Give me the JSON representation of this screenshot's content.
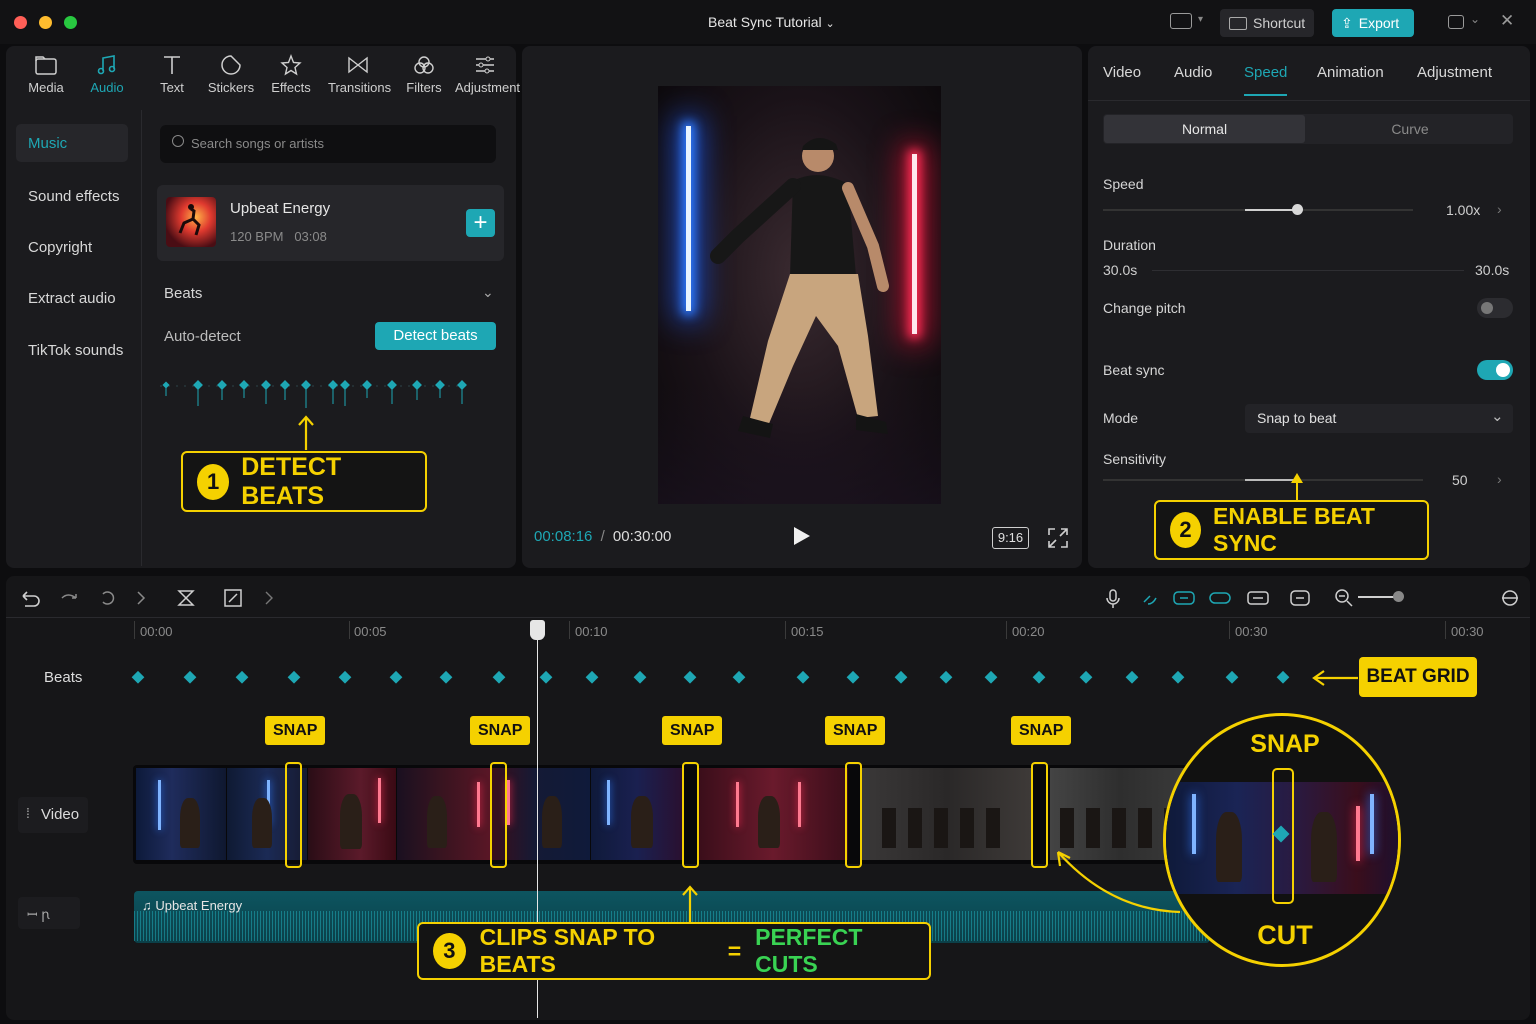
{
  "window": {
    "title": "Beat Sync Tutorial",
    "shortcut_label": "Shortcut",
    "export_label": "Export"
  },
  "toolbar": {
    "tools": [
      "Media",
      "Audio",
      "Text",
      "Stickers",
      "Effects",
      "Transitions",
      "Filters",
      "Adjustment"
    ],
    "active": "Audio"
  },
  "audio_sidebar": {
    "items": [
      "Music",
      "Sound effects",
      "Copyright",
      "Extract audio",
      "TikTok sounds"
    ],
    "active": "Music"
  },
  "search": {
    "placeholder": "Search songs or artists"
  },
  "track": {
    "title": "Upbeat Energy",
    "bpm": "120 BPM",
    "duration": "03:08"
  },
  "beats_section": {
    "title": "Beats",
    "auto_detect": "Auto-detect",
    "detect_button": "Detect beats"
  },
  "callouts": {
    "c1": {
      "number": "1",
      "text": "DETECT BEATS"
    },
    "c2": {
      "number": "2",
      "text": "ENABLE BEAT SYNC"
    },
    "c3": {
      "number": "3",
      "text_a": "CLIPS SNAP TO BEATS",
      "equals": "=",
      "text_b": "PERFECT CUTS"
    },
    "beat_grid": "BEAT GRID",
    "snap": "SNAP",
    "zoom_top": "SNAP",
    "zoom_bottom": "CUT"
  },
  "preview": {
    "current_time": "00:08:16",
    "separator": "/",
    "total_time": "00:30:00",
    "aspect": "9:16"
  },
  "inspector": {
    "tabs": [
      "Video",
      "Audio",
      "Speed",
      "Animation",
      "Adjustment"
    ],
    "active_tab": "Speed",
    "modes": [
      "Normal",
      "Curve"
    ],
    "active_mode": "Normal",
    "speed_label": "Speed",
    "speed_value": "1.00x",
    "speed_level": 0.32,
    "duration_label": "Duration",
    "duration_from": "30.0s",
    "duration_to": "30.0s",
    "change_pitch_label": "Change pitch",
    "change_pitch_on": false,
    "beat_sync_label": "Beat sync",
    "beat_sync_on": true,
    "mode_label": "Mode",
    "mode_value": "Snap to beat",
    "sensitivity_label": "Sensitivity",
    "sensitivity_value": "50"
  },
  "timeline": {
    "ruler": [
      "00:00",
      "00:05",
      "00:10",
      "00:15",
      "00:20",
      "00:30",
      "00:30"
    ],
    "tracks": {
      "beats": "Beats",
      "video": "Video",
      "audio_icon_text": "ꟷ ꞃ"
    },
    "audio_clip_label": "Upbeat Energy"
  },
  "colors": {
    "accent": "#1ea7b4",
    "callout": "#f5d100",
    "callout_green": "#39d353",
    "panel": "#1b1b1e"
  }
}
